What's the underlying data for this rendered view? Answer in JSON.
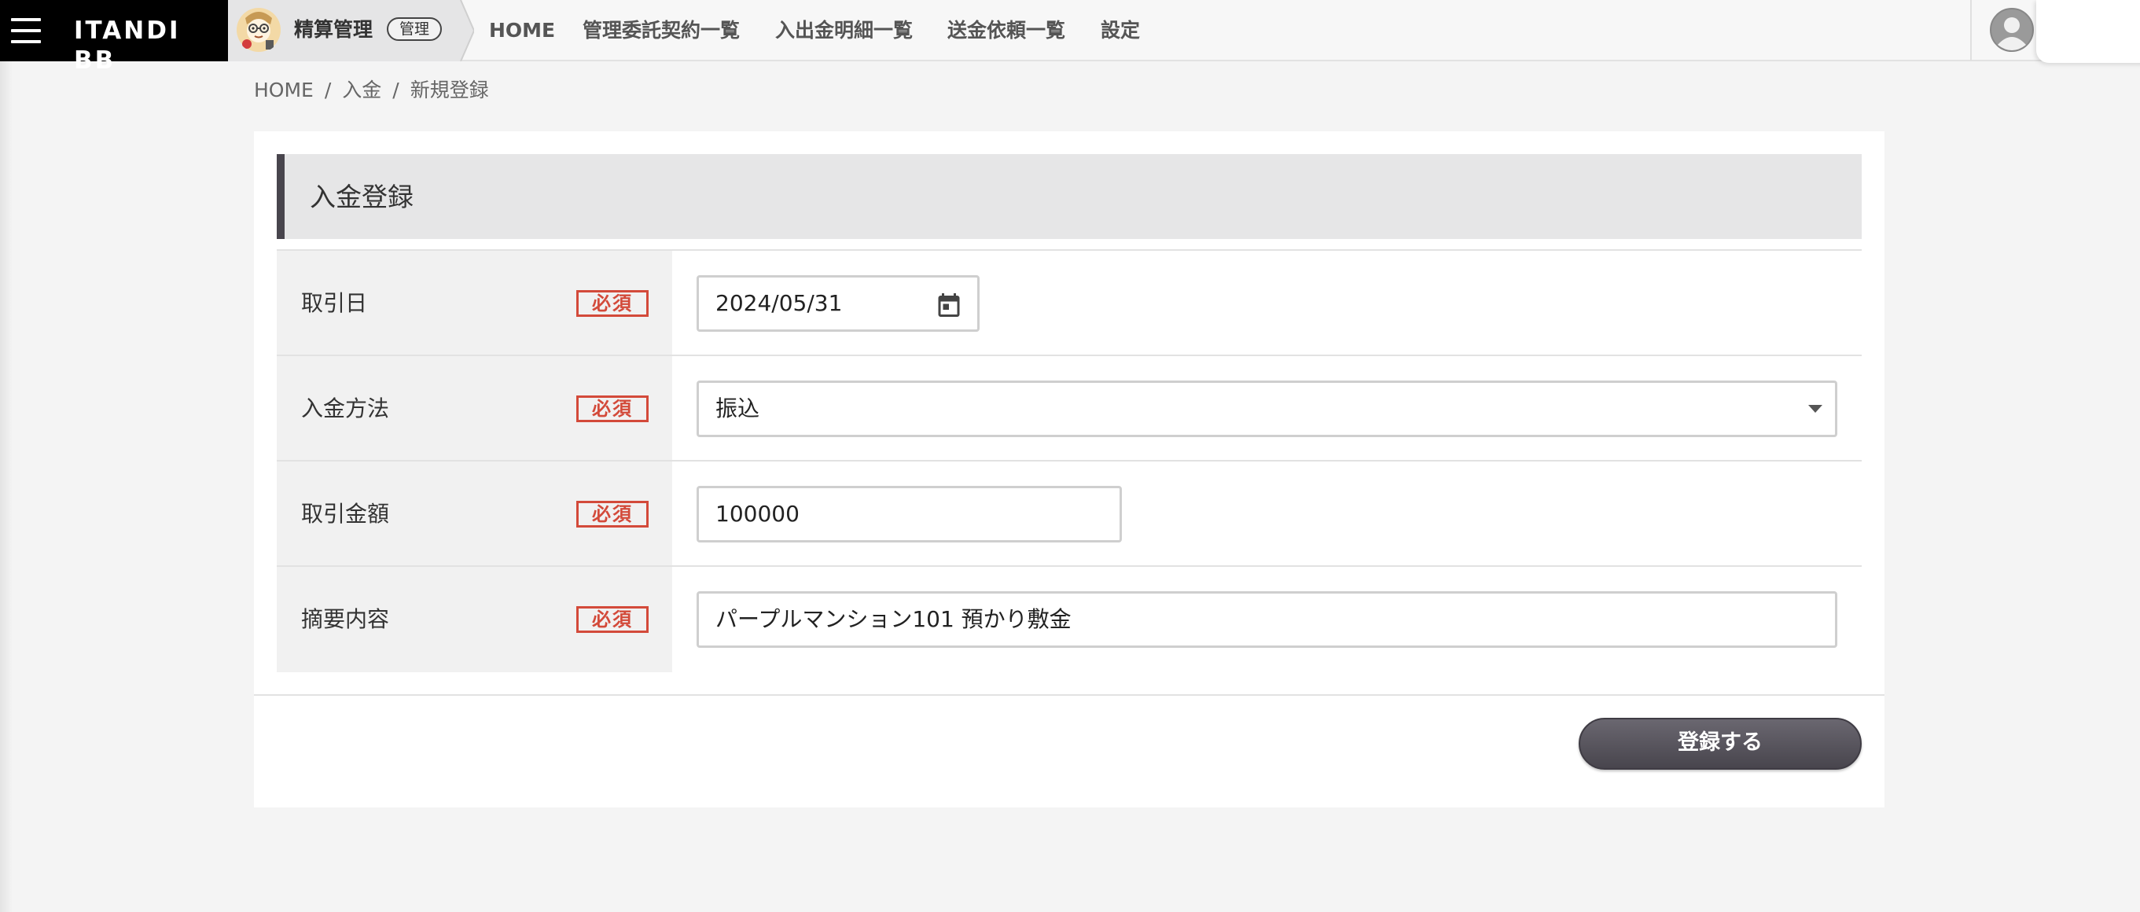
{
  "header": {
    "logo": "ITANDI BB",
    "app": {
      "name": "精算管理",
      "tag": "管理"
    },
    "nav": [
      {
        "label": "HOME"
      },
      {
        "label": "管理委託契約一覧"
      },
      {
        "label": "入出金明細一覧"
      },
      {
        "label": "送金依頼一覧"
      },
      {
        "label": "設定"
      }
    ]
  },
  "breadcrumb": [
    "HOME",
    "入金",
    "新規登録"
  ],
  "form": {
    "title": "入金登録",
    "required_label": "必須",
    "fields": [
      {
        "label": "取引日",
        "value": "2024/05/31"
      },
      {
        "label": "入金方法",
        "value": "振込"
      },
      {
        "label": "取引金額",
        "value": "100000"
      },
      {
        "label": "摘要内容",
        "value": "パープルマンション101 預かり敷金"
      }
    ],
    "submit_label": "登録する"
  },
  "colors": {
    "brand_bar": "#000000",
    "required_red": "#d34a3a",
    "button_dark": "#48454d",
    "section_bg": "#e6e6e7"
  }
}
